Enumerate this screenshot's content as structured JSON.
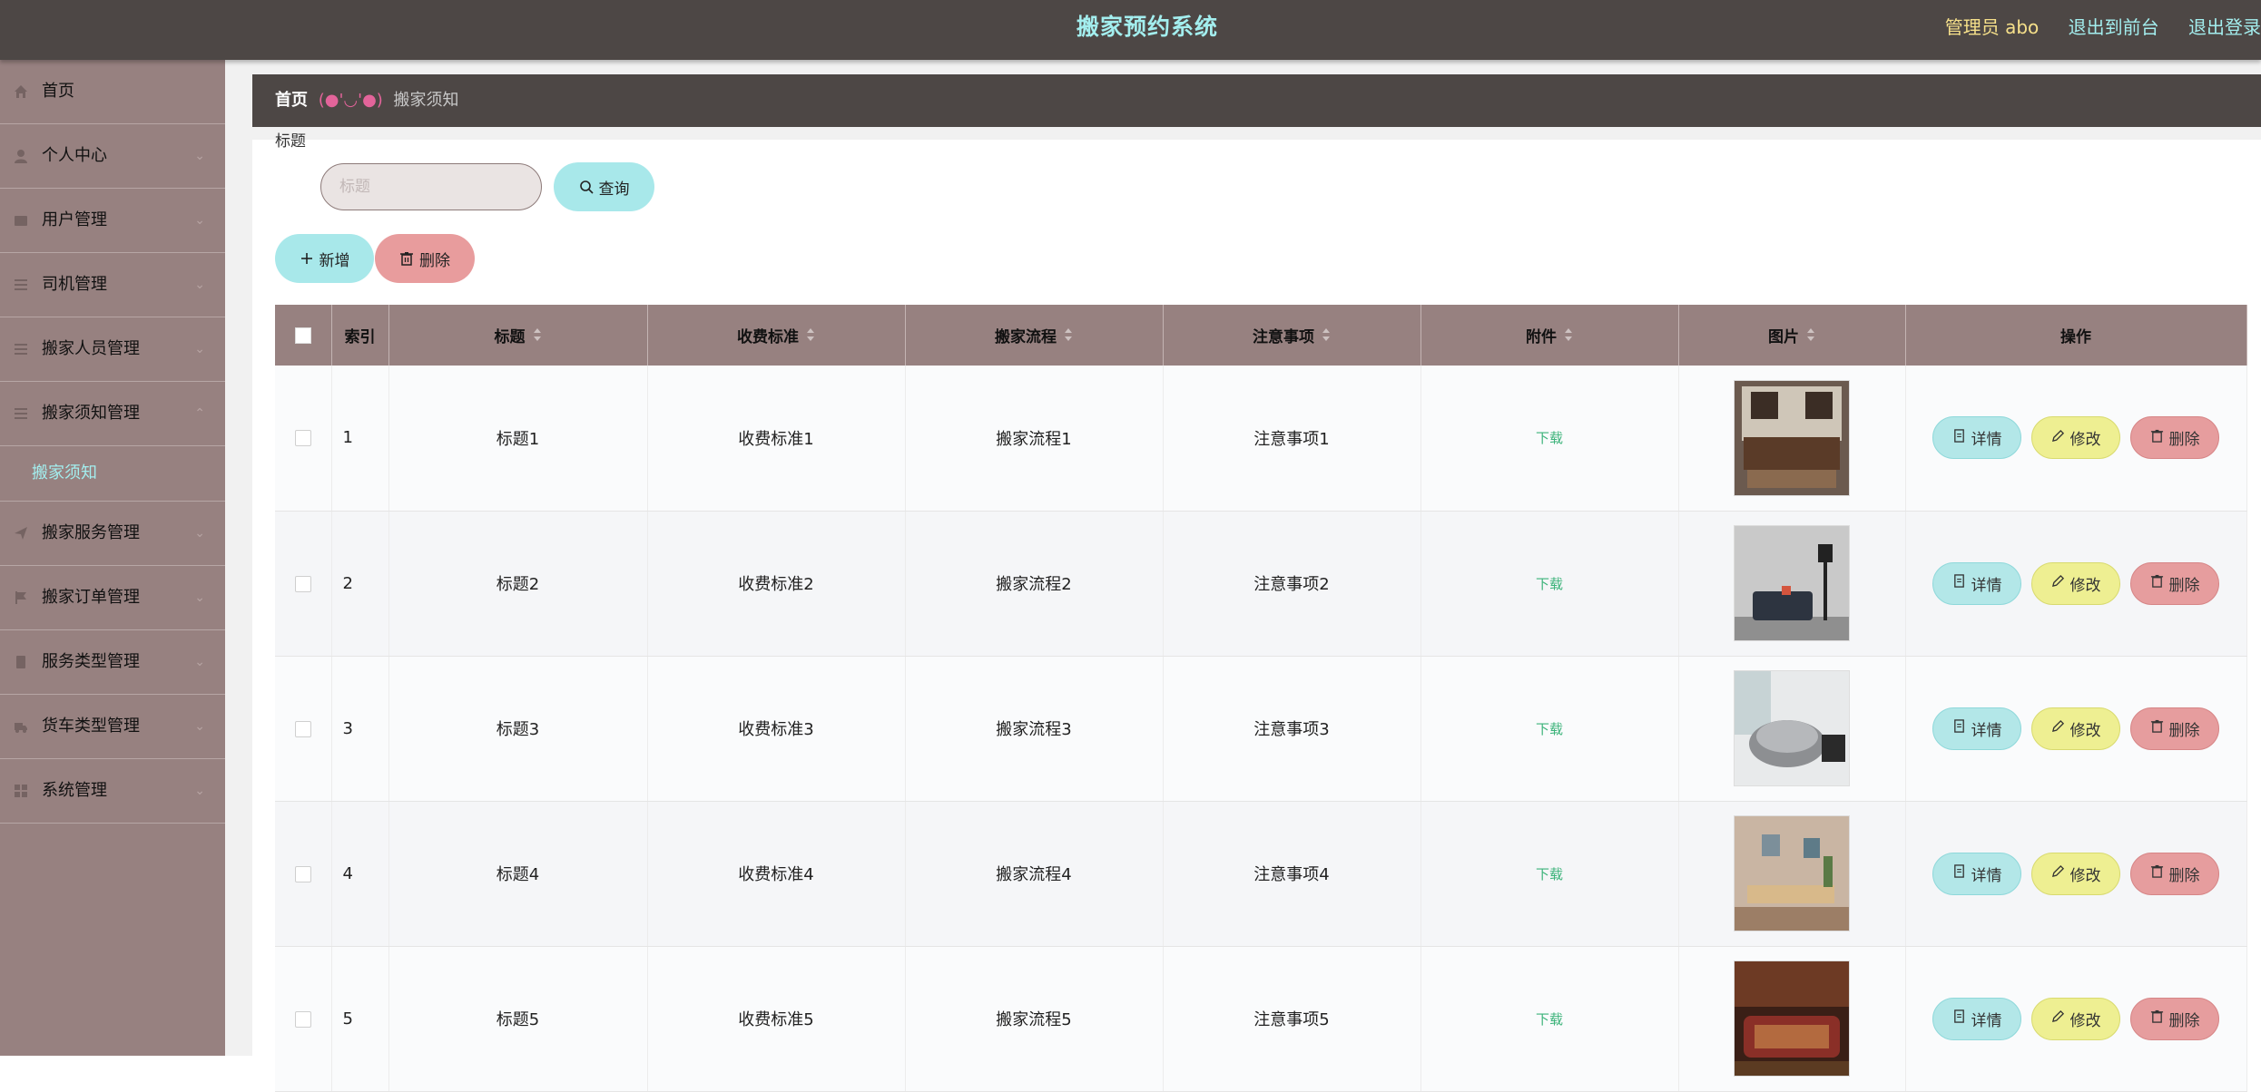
{
  "header": {
    "title": "搬家预约系统",
    "admin": "管理员 abo",
    "front_link": "退出到前台",
    "logout": "退出登录"
  },
  "sidebar": {
    "items": [
      {
        "label": "首页",
        "icon": "home-icon"
      },
      {
        "label": "个人中心",
        "icon": "user-icon"
      },
      {
        "label": "用户管理",
        "icon": "folder-icon"
      },
      {
        "label": "司机管理",
        "icon": "list-icon"
      },
      {
        "label": "搬家人员管理",
        "icon": "list-icon"
      },
      {
        "label": "搬家须知管理",
        "icon": "list-icon",
        "expanded": true
      }
    ],
    "sub_item": "搬家须知",
    "items_after": [
      {
        "label": "搬家服务管理",
        "icon": "send-icon"
      },
      {
        "label": "搬家订单管理",
        "icon": "flag-icon"
      },
      {
        "label": "服务类型管理",
        "icon": "doc-icon"
      },
      {
        "label": "货车类型管理",
        "icon": "truck-icon"
      },
      {
        "label": "系统管理",
        "icon": "grid-icon"
      }
    ]
  },
  "breadcrumb": {
    "home": "首页",
    "separator": "(●'◡'●)",
    "current": "搬家须知"
  },
  "search": {
    "label": "标题",
    "placeholder": "标题",
    "value": "",
    "button": "查询"
  },
  "actions": {
    "add": "新增",
    "delete": "删除"
  },
  "table": {
    "columns": [
      "索引",
      "标题",
      "收费标准",
      "搬家流程",
      "注意事项",
      "附件",
      "图片",
      "操作"
    ],
    "rows": [
      {
        "index": "1",
        "title": "标题1",
        "fee": "收费标准1",
        "process": "搬家流程1",
        "notes": "注意事项1",
        "attachment": "下载",
        "image": "furniture-photo"
      },
      {
        "index": "2",
        "title": "标题2",
        "fee": "收费标准2",
        "process": "搬家流程2",
        "notes": "注意事项2",
        "attachment": "下载",
        "image": "furniture-photo"
      },
      {
        "index": "3",
        "title": "标题3",
        "fee": "收费标准3",
        "process": "搬家流程3",
        "notes": "注意事项3",
        "attachment": "下载",
        "image": "furniture-photo"
      },
      {
        "index": "4",
        "title": "标题4",
        "fee": "收费标准4",
        "process": "搬家流程4",
        "notes": "注意事项4",
        "attachment": "下载",
        "image": "furniture-photo"
      },
      {
        "index": "5",
        "title": "标题5",
        "fee": "收费标准5",
        "process": "搬家流程5",
        "notes": "注意事项5",
        "attachment": "下载",
        "image": "furniture-photo"
      }
    ],
    "row_actions": {
      "detail": "详情",
      "edit": "修改",
      "delete": "删除"
    }
  },
  "colors": {
    "topbar": "#4d4745",
    "sidebar": "#978180",
    "accent_cyan": "#a3eeee",
    "accent_yellow": "#f6e08a",
    "btn_cyan": "#a8e8ea",
    "btn_yellow": "#eeef92",
    "btn_red": "#e89c9d",
    "download_green": "#3cb37a"
  }
}
